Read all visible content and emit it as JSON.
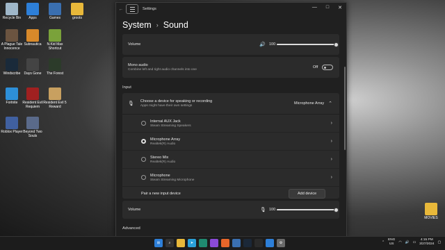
{
  "desktop": {
    "icons": [
      {
        "label": "Recycle Bin",
        "color": "#9fb7c9"
      },
      {
        "label": "Apps",
        "color": "#2d7fd8"
      },
      {
        "label": "Games",
        "color": "#3a6fb0"
      },
      {
        "label": "groots",
        "color": "#e8b83a"
      },
      {
        "label": "A Plague Tale Innocence",
        "color": "#6b5440"
      },
      {
        "label": "Subnautica",
        "color": "#d8892a"
      },
      {
        "label": "N.Kid Max Shortcut",
        "color": "#7aa23a"
      },
      {
        "label": "Windscribe",
        "color": "#1a2a3a"
      },
      {
        "label": "Days Gone",
        "color": "#444444"
      },
      {
        "label": "The Forest",
        "color": "#2c3b2a"
      },
      {
        "label": "Fortnite",
        "color": "#2d8fd8"
      },
      {
        "label": "Resident Evil Requiem",
        "color": "#a02020"
      },
      {
        "label": "Resident Evil 5 Reward",
        "color": "#c8a060"
      },
      {
        "label": "Roblox Player",
        "color": "#4060a0"
      },
      {
        "label": "Beyond Two Souls",
        "color": "#5a6a8a"
      },
      {
        "label": "MOVIES",
        "color": "#e8b83a"
      }
    ]
  },
  "window": {
    "title": "Settings",
    "controls": {
      "minimize": "—",
      "maximize": "□",
      "close": "✕"
    }
  },
  "breadcrumb": {
    "parent": "System",
    "current": "Sound"
  },
  "output": {
    "volume_label": "Volume",
    "volume_value": "100",
    "volume_level": 1.0,
    "mono_title": "Mono audio",
    "mono_desc": "Combine left and right audio channels into one",
    "mono_state": "Off"
  },
  "input": {
    "section_title": "Input",
    "choose_title": "Choose a device for speaking or recording",
    "choose_desc": "Apps might have their own settings",
    "selected_device": "Microphone Array",
    "devices": [
      {
        "name": "Internal AUX Jack",
        "desc": "Steam Streaming Speakers",
        "selected": false
      },
      {
        "name": "Microphone Array",
        "desc": "Realtek(R) Audio",
        "selected": true
      },
      {
        "name": "Stereo Mix",
        "desc": "Realtek(R) Audio",
        "selected": false
      },
      {
        "name": "Microphone",
        "desc": "Steam Streaming Microphone",
        "selected": false
      }
    ],
    "pair_label": "Pair a new input device",
    "add_button": "Add device",
    "volume_label": "Volume",
    "volume_value": "100",
    "volume_level": 1.0
  },
  "advanced": {
    "section_title": "Advanced"
  },
  "taskbar": {
    "icons": [
      {
        "name": "start",
        "color": "#2d7fd8"
      },
      {
        "name": "search",
        "color": "#333333"
      },
      {
        "name": "file-explorer",
        "color": "#e8b83a"
      },
      {
        "name": "telegram",
        "color": "#2aa0d8"
      },
      {
        "name": "edge",
        "color": "#1f8a70"
      },
      {
        "name": "proton",
        "color": "#8a4ad8"
      },
      {
        "name": "firefox",
        "color": "#e8662a"
      },
      {
        "name": "store",
        "color": "#3a6fb0"
      },
      {
        "name": "steam",
        "color": "#1b2838"
      },
      {
        "name": "epic",
        "color": "#2a2a2a"
      },
      {
        "name": "photos",
        "color": "#2d7fd8"
      },
      {
        "name": "settings",
        "color": "#6a6a6a"
      }
    ],
    "lang": "ENG",
    "region": "US",
    "time": "4:15 PM",
    "date": "3/27/2024"
  }
}
